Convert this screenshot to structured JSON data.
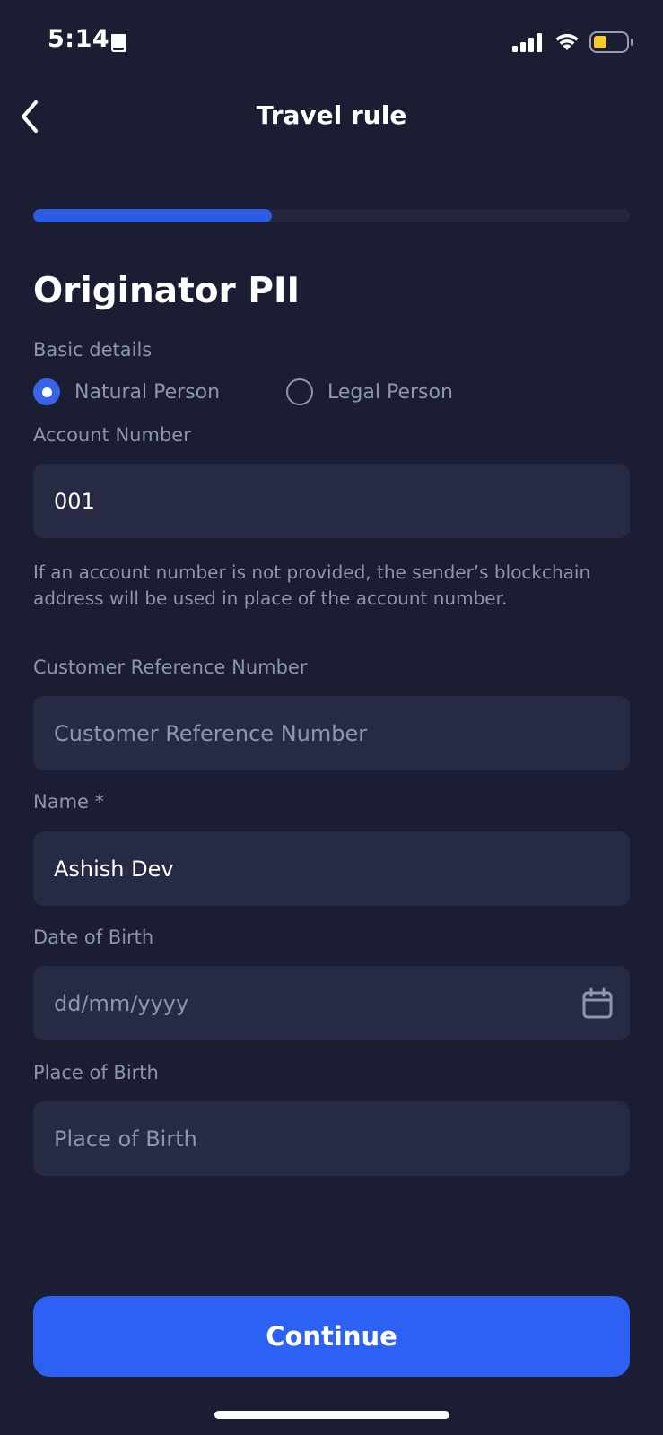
{
  "status_bar": {
    "time": "5:14",
    "icons": [
      "book-icon",
      "signal-icon",
      "wifi-icon",
      "battery-icon"
    ],
    "battery_color": "#f2cc30"
  },
  "header": {
    "title": "Travel rule",
    "back_icon": "chevron-left-icon"
  },
  "progress": {
    "fraction": 0.4,
    "fill_color": "#2d5be3"
  },
  "form": {
    "section_title": "Originator PII",
    "subsection": "Basic details",
    "person_type": {
      "options": [
        {
          "label": "Natural Person",
          "selected": true
        },
        {
          "label": "Legal Person",
          "selected": false
        }
      ]
    },
    "account_number": {
      "label": "Account Number",
      "value": "001",
      "helper": "If an account number is not provided, the sender’s blockchain address will be used in place of the account number."
    },
    "customer_reference": {
      "label": "Customer Reference Number",
      "placeholder": "Customer Reference Number"
    },
    "name": {
      "label": "Name *",
      "value": "Ashish Dev"
    },
    "date_of_birth": {
      "label": "Date of Birth",
      "placeholder": "dd/mm/yyyy",
      "icon": "calendar-icon"
    },
    "place_of_birth": {
      "label": "Place of Birth",
      "placeholder": "Place of Birth"
    }
  },
  "continue_button": {
    "label": "Continue",
    "color": "#2d61f4"
  }
}
